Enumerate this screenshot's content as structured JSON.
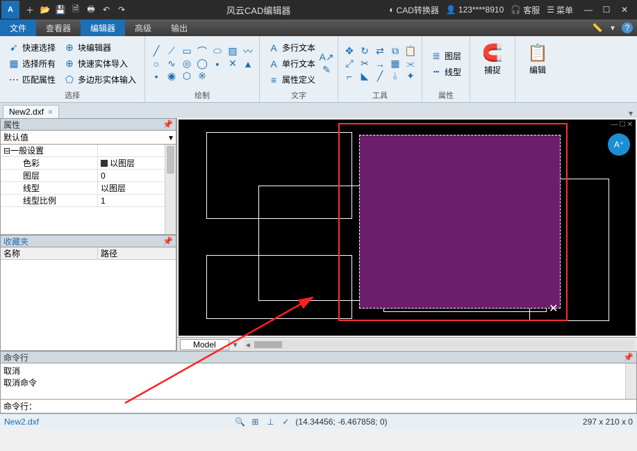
{
  "app": {
    "title": "风云CAD编辑器"
  },
  "titlebar": {
    "converter": "CAD转换器",
    "user": "123****8910",
    "support": "客服",
    "menu": "菜单"
  },
  "menus": {
    "file": "文件",
    "viewer": "查看器",
    "editor": "编辑器",
    "advanced": "高级",
    "output": "输出"
  },
  "ribbon": {
    "select": {
      "quick": "快速选择",
      "all": "选择所有",
      "match": "匹配属性",
      "label": "选择"
    },
    "block": {
      "editor": "块编辑器",
      "import": "快速实体导入",
      "poly": "多边形实体输入",
      "label": ""
    },
    "draw": {
      "label": "绘制"
    },
    "text": {
      "multi": "多行文本",
      "single": "单行文本",
      "attr": "属性定义",
      "label": "文字"
    },
    "tools": {
      "label": "工具"
    },
    "layers": {
      "layer": "图层",
      "linetype": "线型",
      "label": "属性"
    },
    "snap": {
      "label": "捕捉"
    },
    "edit": {
      "label": "编辑"
    }
  },
  "doctab": {
    "name": "New2.dxf"
  },
  "props": {
    "title": "属性",
    "default": "默认值",
    "group1": "一般设置",
    "color": "色彩",
    "color_val": "以图层",
    "layer": "图层",
    "layer_val": "0",
    "linetype": "线型",
    "linetype_val": "以图层",
    "scale": "线型比例",
    "scale_val": "1"
  },
  "fav": {
    "title": "收藏夹",
    "name": "名称",
    "path": "路径"
  },
  "model": {
    "tab": "Model"
  },
  "cmd": {
    "title": "命令行",
    "line1": "取消",
    "line2": "取消命令",
    "prompt": "命令行："
  },
  "status": {
    "file": "New2.dxf",
    "coords": "(14.34456; -6.467858; 0)",
    "dims": "297 x 210 x 0"
  }
}
